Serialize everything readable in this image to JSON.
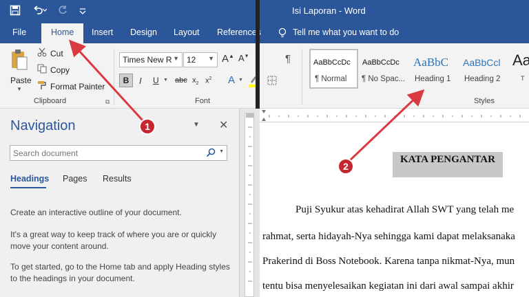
{
  "window": {
    "title": "Isi Laporan - Word"
  },
  "quick_access": {
    "icons": [
      "save-icon",
      "undo-icon",
      "redo-icon",
      "customize-icon"
    ]
  },
  "tabs": [
    {
      "label": "File"
    },
    {
      "label": "Home",
      "active": true
    },
    {
      "label": "Insert"
    },
    {
      "label": "Design"
    },
    {
      "label": "Layout"
    },
    {
      "label": "References"
    }
  ],
  "tell_me": {
    "text": "Tell me what you want to do",
    "icon": "lightbulb-icon"
  },
  "clipboard": {
    "paste": "Paste",
    "cut": "Cut",
    "copy": "Copy",
    "format_painter": "Format Painter",
    "group_label": "Clipboard"
  },
  "font": {
    "family": "Times New R",
    "size": "12",
    "group_label": "Font"
  },
  "styles": {
    "items": [
      {
        "preview": "AaBbCcDc",
        "name": "¶ Normal"
      },
      {
        "preview": "AaBbCcDc",
        "name": "¶ No Spac..."
      },
      {
        "preview": "AaBbC",
        "name": "Heading 1"
      },
      {
        "preview": "AaBbCcl",
        "name": "Heading 2"
      },
      {
        "preview": "Aa",
        "name": "T"
      }
    ],
    "group_label": "Styles"
  },
  "navigation": {
    "title": "Navigation",
    "search_placeholder": "Search document",
    "tabs": [
      "Headings",
      "Pages",
      "Results"
    ],
    "active_tab": "Headings",
    "paragraphs": [
      "Create an interactive outline of your document.",
      "It's a great way to keep track of where you are or quickly move your content around.",
      "To get started, go to the Home tab and apply Heading styles to the headings in your document."
    ]
  },
  "document": {
    "heading": "KATA PENGANTAR",
    "lines": [
      "Puji Syukur atas kehadirat Allah SWT yang telah me",
      "rahmat, serta hidayah-Nya sehingga kami dapat melaksanaka",
      "Prakerind di Boss Notebook. Karena tanpa nikmat-Nya, mun",
      "tentu bisa menyelesaikan kegiatan ini dari awal sampai akhir"
    ]
  },
  "annotations": {
    "badge_1": "1",
    "badge_2": "2",
    "arrow_color": "#d9393f"
  },
  "colors": {
    "accent": "#2b579a",
    "ribbon": "#f3f3f3",
    "nav_bg": "#f0f0f0"
  }
}
